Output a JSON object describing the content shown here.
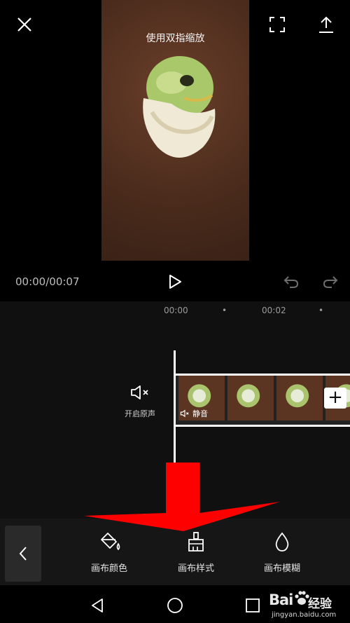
{
  "preview": {
    "hint": "使用双指缩放"
  },
  "playback": {
    "time_readout": "00:00/00:07"
  },
  "ruler": {
    "marks": [
      "00:00",
      "00:02"
    ]
  },
  "track": {
    "mute_label": "开启原声",
    "clip_mute_label": "静音",
    "add_label": "+"
  },
  "toolbar": {
    "tools": [
      {
        "label": "画布颜色",
        "icon": "paint-bucket-icon"
      },
      {
        "label": "画布样式",
        "icon": "brush-icon"
      },
      {
        "label": "画布模糊",
        "icon": "droplet-icon"
      }
    ]
  },
  "watermark": {
    "logo": "Bai",
    "logo_cn": "经验",
    "url": "jingyan.baidu.com"
  },
  "colors": {
    "background": "#101010",
    "toolbar": "#161616",
    "annotation_arrow": "#ff0000"
  }
}
